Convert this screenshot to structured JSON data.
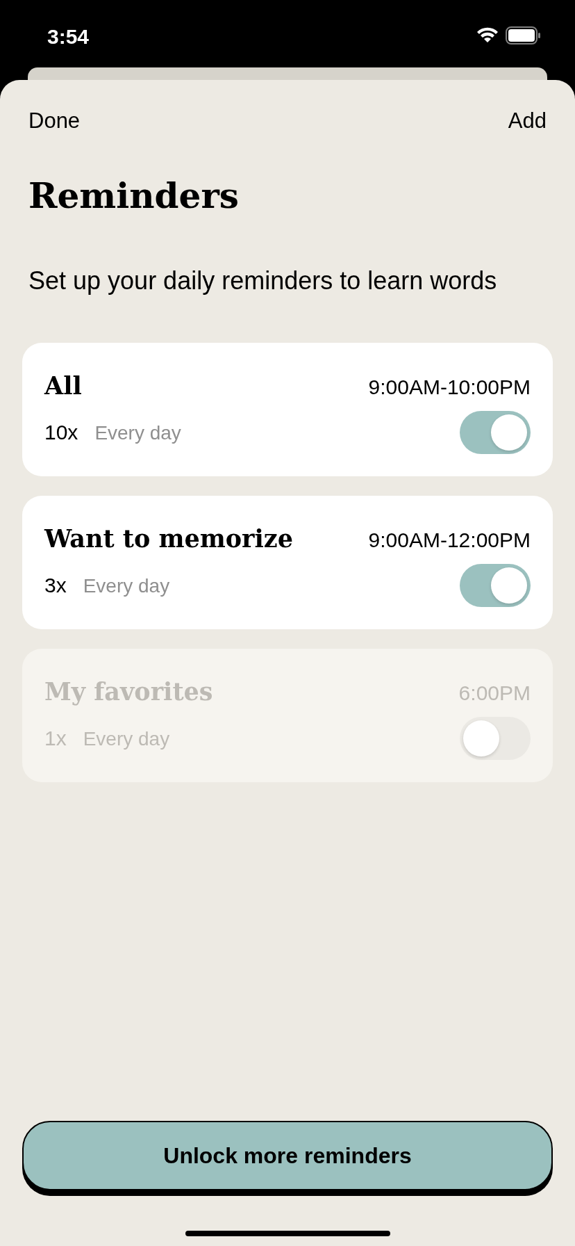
{
  "status_bar": {
    "time": "3:54"
  },
  "nav": {
    "left": "Done",
    "right": "Add"
  },
  "title": "Reminders",
  "subtitle": "Set up your daily reminders to learn words",
  "reminders": [
    {
      "name": "All",
      "time_range": "9:00AM-10:00PM",
      "count": "10x",
      "frequency": "Every day",
      "on": true,
      "disabled": false
    },
    {
      "name": "Want to memorize",
      "time_range": "9:00AM-12:00PM",
      "count": "3x",
      "frequency": "Every day",
      "on": true,
      "disabled": false
    },
    {
      "name": "My favorites",
      "time_range": "6:00PM",
      "count": "1x",
      "frequency": "Every day",
      "on": false,
      "disabled": true
    }
  ],
  "unlock_button": "Unlock more reminders"
}
